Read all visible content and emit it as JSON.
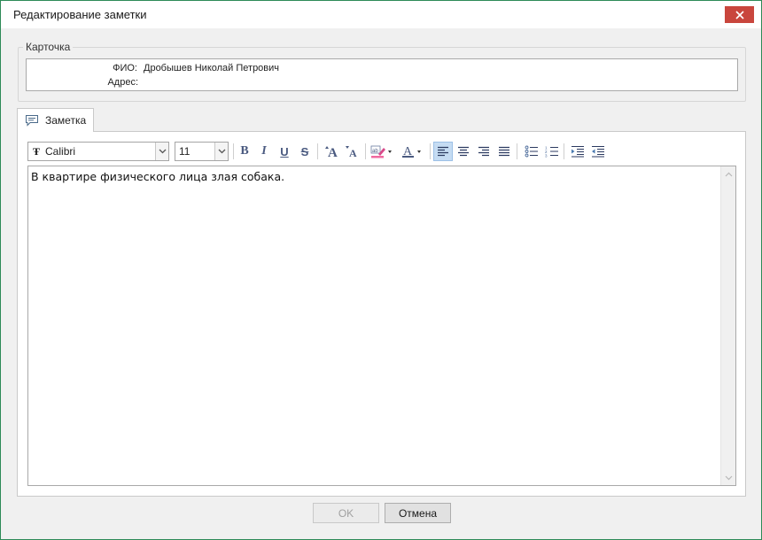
{
  "window": {
    "title": "Редактирование заметки"
  },
  "card": {
    "legend": "Карточка",
    "fio_label": "ФИО:",
    "fio_value": "Дробышев Николай Петрович",
    "address_label": "Адрес:",
    "address_value": ""
  },
  "tab": {
    "label": "Заметка"
  },
  "toolbar": {
    "font_name": "Calibri",
    "font_size": "11",
    "bold": "B",
    "italic": "I",
    "underline": "U",
    "strike": "S",
    "font_color_letter": "A"
  },
  "editor": {
    "text": "В квартире физического лица злая собака."
  },
  "buttons": {
    "ok": "OK",
    "cancel": "Отмена"
  },
  "colors": {
    "close_button": "#c9463d",
    "window_border": "#2d8a57",
    "active_align": "#c5dcf3"
  }
}
